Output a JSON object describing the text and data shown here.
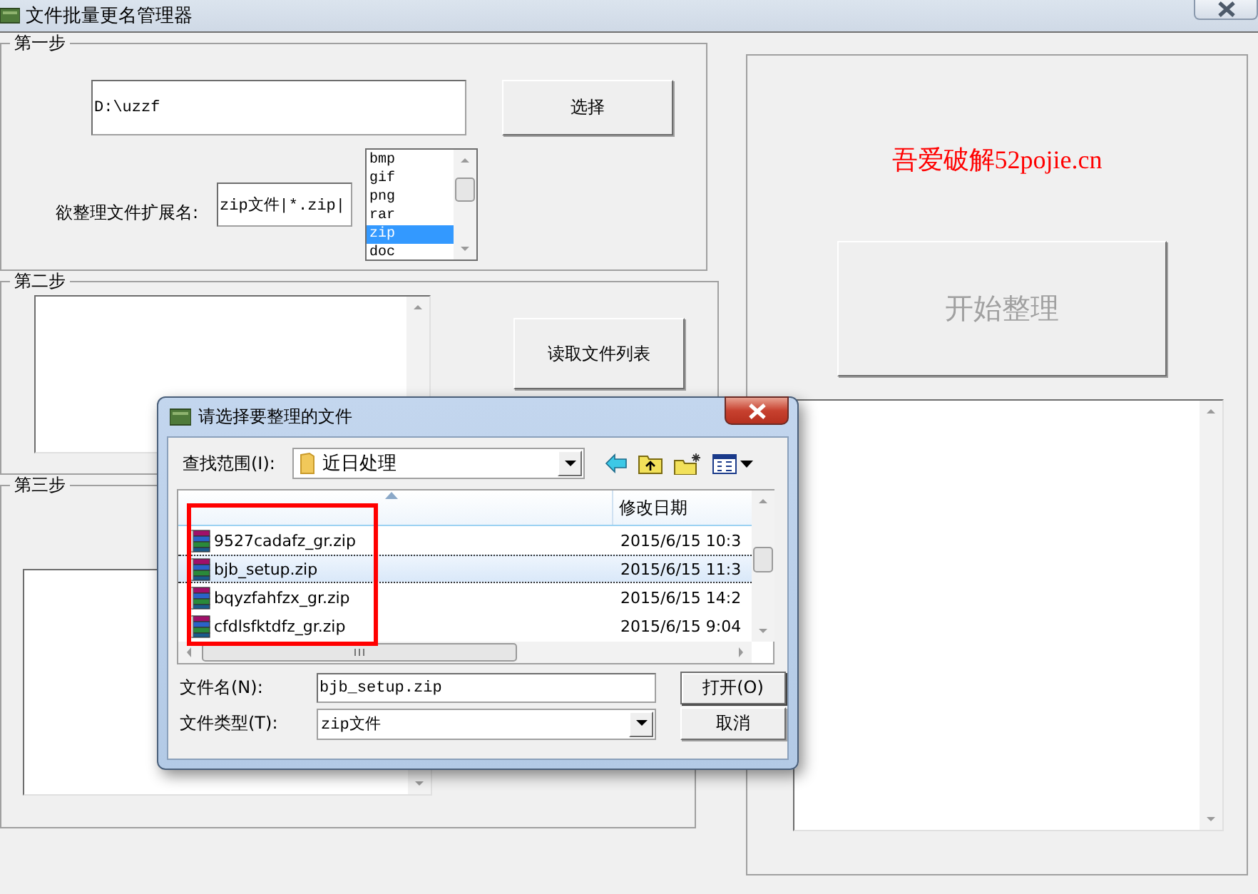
{
  "window": {
    "title": "文件批量更名管理器"
  },
  "step1": {
    "legend": "第一步",
    "path": "D:\\uzzf",
    "choose_button": "选择",
    "ext_label": "欲整理文件扩展名:",
    "ext_value": "zip文件|*.zip|",
    "ext_list": [
      {
        "label": "bmp",
        "selected": false
      },
      {
        "label": "gif",
        "selected": false
      },
      {
        "label": "png",
        "selected": false
      },
      {
        "label": "rar",
        "selected": false
      },
      {
        "label": "zip",
        "selected": true
      },
      {
        "label": "doc",
        "selected": false
      }
    ]
  },
  "step2": {
    "legend": "第二步",
    "read_button": "读取文件列表"
  },
  "step3": {
    "legend": "第三步"
  },
  "side": {
    "banner": "吾爱破解52pojie.cn",
    "start_button": {
      "label": "开始整理",
      "disabled": true
    }
  },
  "dialog": {
    "title": "请选择要整理的文件",
    "look_in_label": "查找范围(I):",
    "look_in_value": "近日处理",
    "date_column": "修改日期",
    "files": [
      {
        "name": "9527cadafz_gr.zip",
        "modified": "2015/6/15 10:3",
        "selected": false
      },
      {
        "name": "bjb_setup.zip",
        "modified": "2015/6/15 11:3",
        "selected": true
      },
      {
        "name": "bqyzfahfzx_gr.zip",
        "modified": "2015/6/15 14:2",
        "selected": false
      },
      {
        "name": "cfdlsfktdfz_gr.zip",
        "modified": "2015/6/15 9:04",
        "selected": false
      }
    ],
    "file_name_label": "文件名(N):",
    "file_name_value": "bjb_setup.zip",
    "file_type_label": "文件类型(T):",
    "file_type_value": "zip文件",
    "open_button": "打开(O)",
    "cancel_button": "取消"
  }
}
